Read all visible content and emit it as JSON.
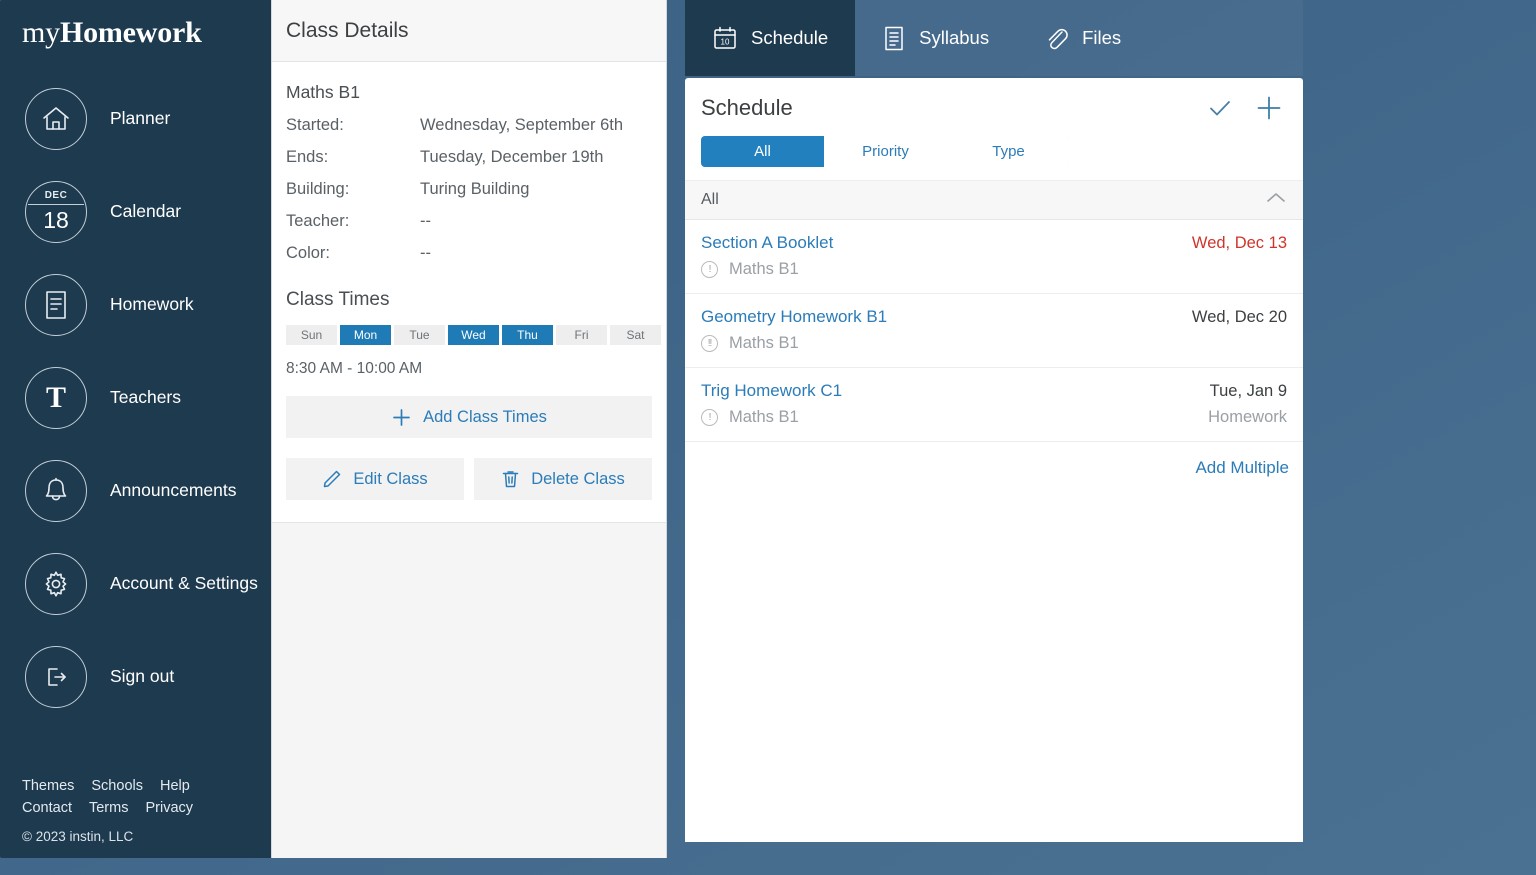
{
  "app": {
    "logo_light": "my",
    "logo_bold": "Homework"
  },
  "sidebar": {
    "items": [
      {
        "label": "Planner",
        "icon": "home-icon"
      },
      {
        "label": "Calendar",
        "icon": "calendar-icon",
        "month": "DEC",
        "day": "18"
      },
      {
        "label": "Homework",
        "icon": "document-icon"
      },
      {
        "label": "Teachers",
        "icon": "teacher-t-icon"
      },
      {
        "label": "Announcements",
        "icon": "bell-icon"
      },
      {
        "label": "Account & Settings",
        "icon": "gear-icon"
      },
      {
        "label": "Sign out",
        "icon": "sign-out-icon"
      }
    ],
    "footer": {
      "row1": [
        "Themes",
        "Schools",
        "Help"
      ],
      "row2": [
        "Contact",
        "Terms",
        "Privacy"
      ],
      "copyright": "© 2023 instin, LLC"
    }
  },
  "details": {
    "header_title": "Class Details",
    "class_name": "Maths B1",
    "fields": [
      {
        "key": "Started:",
        "value": "Wednesday, September 6th"
      },
      {
        "key": "Ends:",
        "value": "Tuesday, December 19th"
      },
      {
        "key": "Building:",
        "value": "Turing Building"
      },
      {
        "key": "Teacher:",
        "value": "--"
      },
      {
        "key": "Color:",
        "value": "--"
      }
    ],
    "class_times_title": "Class Times",
    "days": [
      {
        "label": "Sun",
        "selected": false
      },
      {
        "label": "Mon",
        "selected": true
      },
      {
        "label": "Tue",
        "selected": false
      },
      {
        "label": "Wed",
        "selected": true
      },
      {
        "label": "Thu",
        "selected": true
      },
      {
        "label": "Fri",
        "selected": false
      },
      {
        "label": "Sat",
        "selected": false
      }
    ],
    "time_range": "8:30 AM - 10:00 AM",
    "add_class_times_label": "Add Class Times",
    "edit_class_label": "Edit Class",
    "delete_class_label": "Delete Class"
  },
  "tabs": [
    {
      "label": "Schedule",
      "icon": "calendar-10-icon",
      "active": true
    },
    {
      "label": "Syllabus",
      "icon": "document-lines-icon",
      "active": false
    },
    {
      "label": "Files",
      "icon": "paperclip-icon",
      "active": false
    }
  ],
  "schedule": {
    "title": "Schedule",
    "check_icon": "check-icon",
    "add_icon": "plus-icon",
    "filters": [
      {
        "label": "All",
        "active": true
      },
      {
        "label": "Priority",
        "active": false
      },
      {
        "label": "Type",
        "active": false
      }
    ],
    "group_label": "All",
    "collapse_icon": "chevron-up-icon",
    "tasks": [
      {
        "title": "Section A Booklet",
        "class": "Maths B1",
        "date": "Wed, Dec 13",
        "overdue": true,
        "priority": "!",
        "type": ""
      },
      {
        "title": "Geometry Homework B1",
        "class": "Maths B1",
        "date": "Wed, Dec 20",
        "overdue": false,
        "priority": "!!",
        "type": ""
      },
      {
        "title": "Trig Homework C1",
        "class": "Maths B1",
        "date": "Tue, Jan 9",
        "overdue": false,
        "priority": "!",
        "type": "Homework"
      }
    ],
    "add_multiple_label": "Add Multiple"
  },
  "colors": {
    "accent": "#2180bd",
    "sidebar_bg": "#1e3a4f",
    "page_bg": "#3e6487",
    "overdue": "#d0342c",
    "link": "#2b7cb8"
  }
}
